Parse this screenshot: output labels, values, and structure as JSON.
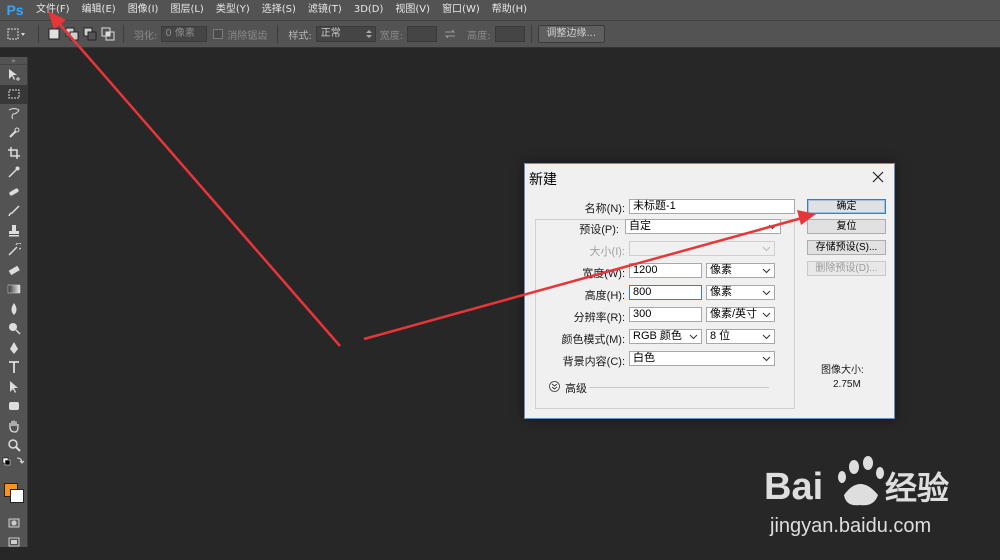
{
  "app": {
    "logo": "Ps"
  },
  "menu": [
    "文件(F)",
    "编辑(E)",
    "图像(I)",
    "图层(L)",
    "类型(Y)",
    "选择(S)",
    "滤镜(T)",
    "3D(D)",
    "视图(V)",
    "窗口(W)",
    "帮助(H)"
  ],
  "options": {
    "feather_label": "羽化:",
    "feather_value": "0 像素",
    "antialias_label": "消除锯齿",
    "style_label": "样式:",
    "style_value": "正常",
    "width_label": "宽度:",
    "height_label": "高度:",
    "refine_edge": "调整边缘..."
  },
  "tools": [
    "move",
    "marquee",
    "lasso",
    "quick-select",
    "crop",
    "eyedropper",
    "healing",
    "brush",
    "stamp",
    "history-brush",
    "eraser",
    "gradient",
    "blur",
    "dodge",
    "pen",
    "type",
    "path-select",
    "shape",
    "hand",
    "zoom"
  ],
  "colors": {
    "foreground": "#f7931e",
    "background": "#ffffff",
    "accent": "#31a8ff",
    "arrow": "#e8353a"
  },
  "dialog": {
    "title": "新建",
    "name_label": "名称(N):",
    "name_value": "未标题-1",
    "preset_label": "预设(P):",
    "preset_value": "自定",
    "size_label": "大小(I):",
    "width_label": "宽度(W):",
    "width_value": "1200",
    "width_unit": "像素",
    "height_label": "高度(H):",
    "height_value": "800",
    "height_unit": "像素",
    "resolution_label": "分辨率(R):",
    "resolution_value": "300",
    "resolution_unit": "像素/英寸",
    "color_mode_label": "颜色模式(M):",
    "color_mode_value": "RGB 颜色",
    "bit_depth_value": "8 位",
    "background_label": "背景内容(C):",
    "background_value": "白色",
    "advanced_label": "高级",
    "ok": "确定",
    "reset": "复位",
    "save_preset": "存储预设(S)...",
    "delete_preset": "删除预设(D)...",
    "image_size_label": "图像大小:",
    "image_size_value": "2.75M"
  },
  "watermark": {
    "url": "jingyan.baidu.com"
  }
}
